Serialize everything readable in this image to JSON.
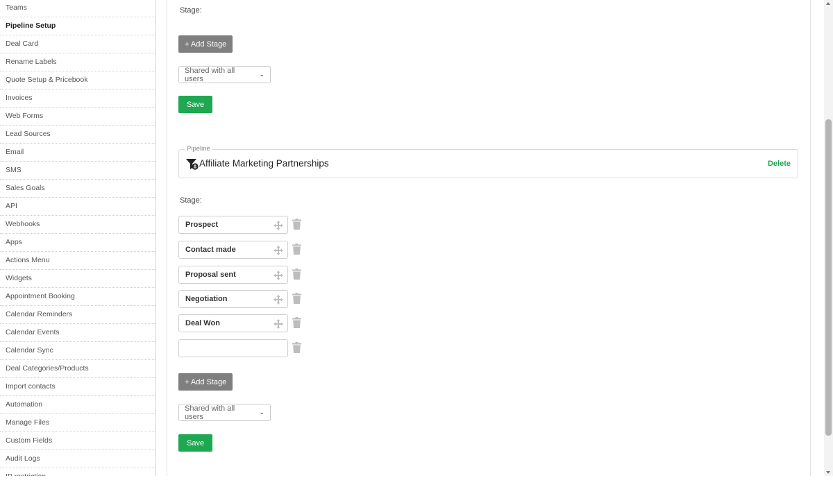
{
  "sidebar": {
    "items": [
      {
        "label": "Teams"
      },
      {
        "label": "Pipeline Setup",
        "active": true
      },
      {
        "label": "Deal Card"
      },
      {
        "label": "Rename Labels"
      },
      {
        "label": "Quote Setup & Pricebook"
      },
      {
        "label": "Invoices"
      },
      {
        "label": "Web Forms"
      },
      {
        "label": "Lead Sources"
      },
      {
        "label": "Email"
      },
      {
        "label": "SMS"
      },
      {
        "label": "Sales Goals"
      },
      {
        "label": "API"
      },
      {
        "label": "Webhooks"
      },
      {
        "label": "Apps"
      },
      {
        "label": "Actions Menu"
      },
      {
        "label": "Widgets"
      },
      {
        "label": "Appointment Booking"
      },
      {
        "label": "Calendar Reminders"
      },
      {
        "label": "Calendar Events"
      },
      {
        "label": "Calendar Sync"
      },
      {
        "label": "Deal Categories/Products"
      },
      {
        "label": "Import contacts"
      },
      {
        "label": "Automation"
      },
      {
        "label": "Manage Files"
      },
      {
        "label": "Custom Fields"
      },
      {
        "label": "Audit Logs"
      },
      {
        "label": "IP restriction"
      }
    ]
  },
  "top_section": {
    "stage_label": "Stage:",
    "add_stage_label": "+ Add Stage",
    "share_value": "Shared with all users",
    "save_label": "Save"
  },
  "pipeline": {
    "legend": "Pipeline",
    "name": "Affiliate Marketing Partnerships",
    "delete_label": "Delete",
    "stage_label": "Stage:",
    "stages": [
      "Prospect",
      "Contact made",
      "Proposal sent",
      "Negotiation",
      "Deal Won",
      ""
    ],
    "add_stage_label": "+ Add Stage",
    "share_value": "Shared with all users",
    "save_label": "Save"
  },
  "colors": {
    "save_green": "#1da851",
    "add_gray": "#7f7f7f",
    "delete_green": "#1da851"
  }
}
